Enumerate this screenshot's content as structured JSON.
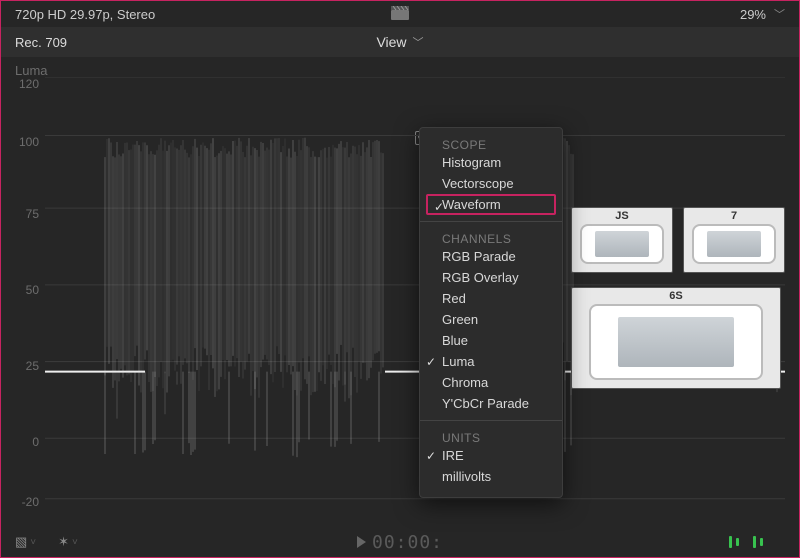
{
  "topbar": {
    "format": "720p HD 29.97p, Stereo",
    "zoom": "29%"
  },
  "secondbar": {
    "colorspace": "Rec. 709",
    "view_label": "View"
  },
  "scope": {
    "title": "Luma",
    "y_ticks": [
      "120",
      "100",
      "75",
      "50",
      "25",
      "0",
      "-20"
    ]
  },
  "menu": {
    "sections": {
      "scope": {
        "label": "SCOPE",
        "items": [
          "Histogram",
          "Vectorscope",
          "Waveform"
        ],
        "selected": "Waveform"
      },
      "channels": {
        "label": "CHANNELS",
        "items": [
          "RGB Parade",
          "RGB Overlay",
          "Red",
          "Green",
          "Blue",
          "Luma",
          "Chroma",
          "Y'CbCr Parade"
        ],
        "selected": "Luma"
      },
      "units": {
        "label": "UNITS",
        "items": [
          "IRE",
          "millivolts"
        ],
        "selected": "IRE"
      }
    }
  },
  "thumbnails": {
    "row1": [
      {
        "label": "JS"
      },
      {
        "label": "7"
      }
    ],
    "big": {
      "label": "6S"
    }
  },
  "bottombar": {
    "timecode": "00:00:"
  },
  "colors": {
    "accent": "#c72360",
    "bg": "#262626",
    "panel": "#2c2c2c"
  }
}
